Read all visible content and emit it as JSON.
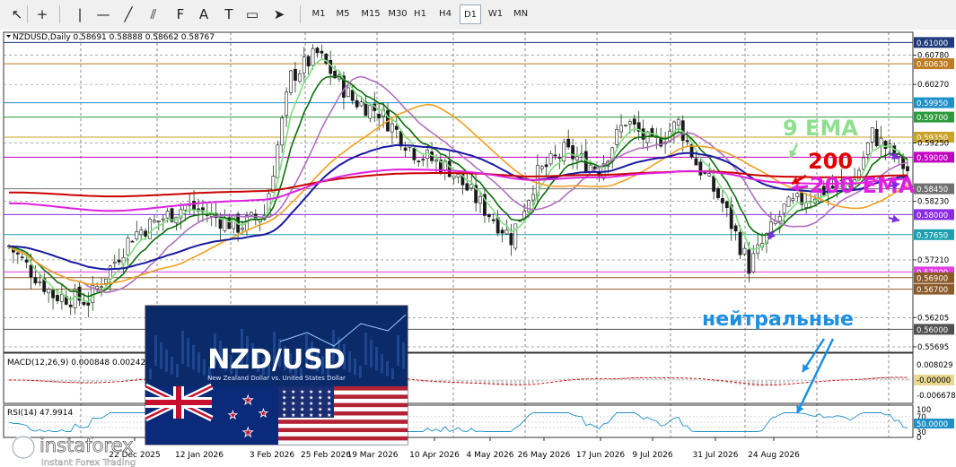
{
  "toolbar": {
    "timeframes": [
      "M1",
      "M5",
      "M15",
      "M30",
      "H1",
      "H4",
      "D1",
      "W1",
      "MN"
    ],
    "active": "D1",
    "tools": [
      "cursor-icon",
      "crosshair-icon",
      "vertical-line-icon",
      "horizontal-line-icon",
      "trendline-icon",
      "channel-icon",
      "fibonacci-icon",
      "text-icon",
      "label-icon",
      "shapes-icon",
      "arrows-icon"
    ]
  },
  "chart_data": {
    "type": "candlestick",
    "symbol_info": "NZDUSD,Daily  0.58691 0.58888 0.58662 0.58767",
    "price_ticks": [
      "0.61000",
      "0.60780",
      "0.60630",
      "0.60270",
      "0.59950",
      "0.59700",
      "0.59350",
      "0.59250",
      "0.59000",
      "0.58450",
      "0.58230",
      "0.58000",
      "0.57650",
      "0.57210",
      "0.57000",
      "0.56900",
      "0.56700",
      "0.56205",
      "0.56000",
      "0.55695"
    ],
    "highlight_levels": [
      {
        "price": "0.61000",
        "color": "#1f3a7a"
      },
      {
        "price": "0.60630",
        "color": "#c07a20"
      },
      {
        "price": "0.59950",
        "color": "#1e90c8"
      },
      {
        "price": "0.59700",
        "color": "#2e9a3e"
      },
      {
        "price": "0.59350",
        "color": "#c9a227"
      },
      {
        "price": "0.59000",
        "color": "#c000c0"
      },
      {
        "price": "0.58450",
        "color": "#707070"
      },
      {
        "price": "0.58000",
        "color": "#8a2be2"
      },
      {
        "price": "0.57650",
        "color": "#1fa0b0"
      },
      {
        "price": "0.57000",
        "color": "#e040e0"
      },
      {
        "price": "0.56900",
        "color": "#8b5a2b"
      },
      {
        "price": "0.56700",
        "color": "#8b5a2b"
      },
      {
        "price": "0.56000",
        "color": "#505050"
      }
    ],
    "dates": [
      "22 Dec 2025",
      "12 Jan 2026",
      "3 Feb 2026",
      "25 Feb 2026",
      "19 Mar 2026",
      "10 Apr 2026",
      "4 May 2026",
      "26 May 2026",
      "17 Jun 2026",
      "9 Jul 2026",
      "31 Jul 2026",
      "24 Aug 2026"
    ],
    "annotations": {
      "ema9": "9 EMA",
      "ma200": "200",
      "ema200": "200 EMA",
      "neutral": "нейтральные"
    },
    "series_colors": {
      "price": "#1a7a1a",
      "ema_fast": "#7fe07f",
      "ema_slow": "#0a6e0a",
      "purple_ma": "#b070c0",
      "orange_ma": "#f0a020",
      "blue_ma": "#1a1aa0",
      "red_ma": "#cc0000",
      "magenta_ma": "#e020e0"
    },
    "macd": {
      "label": "MACD(12,26,9) 0.000848 0.002422",
      "ticks": [
        "0.008029",
        "-0.00000",
        "-0.006678"
      ]
    },
    "rsi": {
      "label": "RSI(14) 47.9914",
      "ticks": [
        "100",
        "70",
        "50.0000",
        "30",
        "0"
      ]
    }
  },
  "inset": {
    "title": "NZD/USD",
    "subtitle": "New Zealand Dollar vs. United States Dollar"
  },
  "watermark": {
    "brand": "instaforex",
    "tagline": "Instant Forex Trading"
  }
}
